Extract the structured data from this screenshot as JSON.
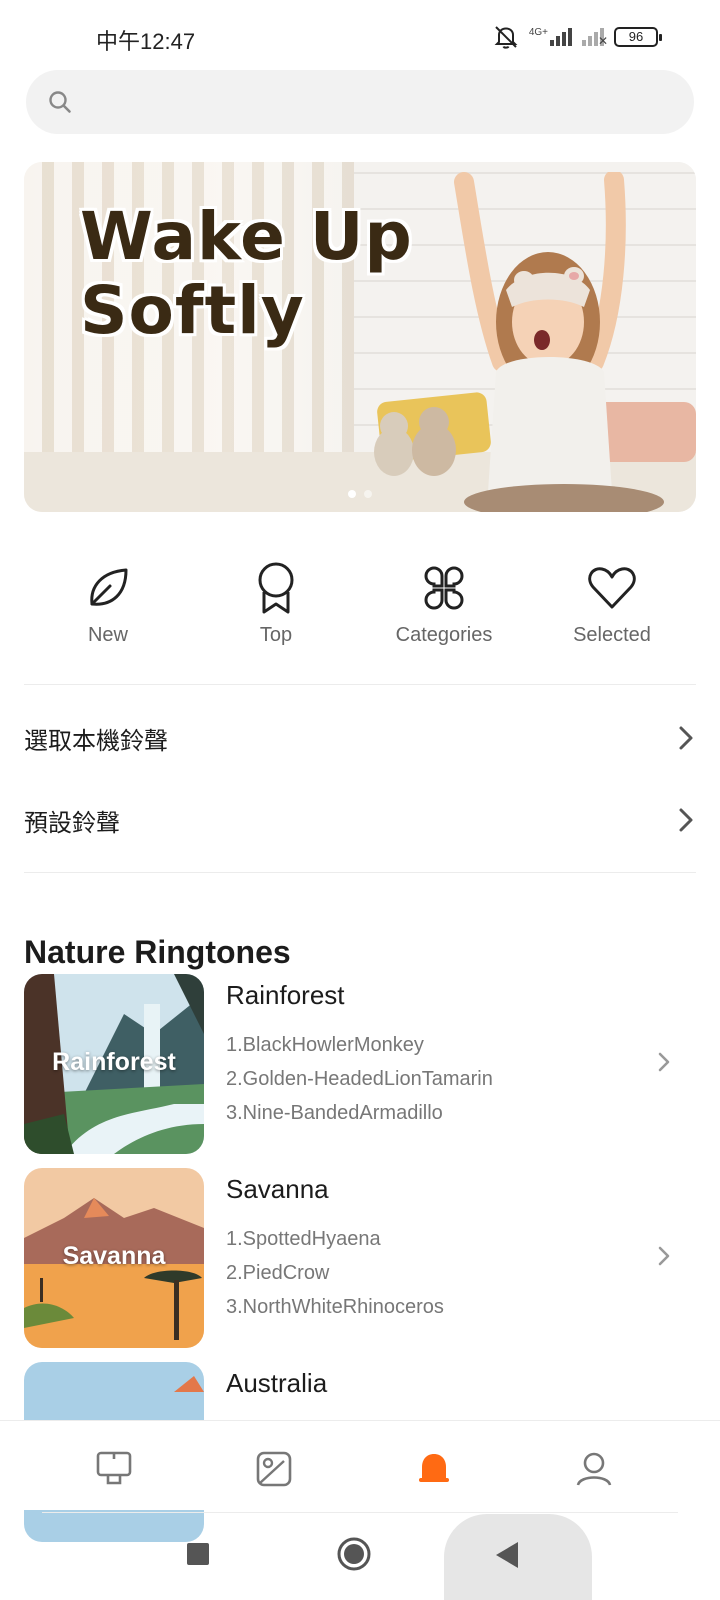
{
  "status_bar": {
    "time": "中午12:47",
    "network": "4G+",
    "battery": "96"
  },
  "search": {
    "placeholder": ""
  },
  "banner": {
    "title_line1": "Wake Up",
    "title_line2": "Softly",
    "page_count": 2,
    "active_page": 1
  },
  "quick_nav": [
    {
      "label": "New",
      "icon": "leaf-icon"
    },
    {
      "label": "Top",
      "icon": "ribbon-badge-icon"
    },
    {
      "label": "Categories",
      "icon": "clover-grid-icon"
    },
    {
      "label": "Selected",
      "icon": "heart-icon"
    }
  ],
  "menu": {
    "local_ringtone": "選取本機鈴聲",
    "default_ringtone": "預設鈴聲"
  },
  "section": {
    "title": "Nature Ringtones"
  },
  "cards": [
    {
      "title": "Rainforest",
      "thumb_label": "Rainforest",
      "items": [
        "1.BlackHowlerMonkey",
        "2.Golden-HeadedLionTamarin",
        "3.Nine-BandedArmadillo"
      ]
    },
    {
      "title": "Savanna",
      "thumb_label": "Savanna",
      "items": [
        "1.SpottedHyaena",
        "2.PiedCrow",
        "3.NorthWhiteRhinoceros"
      ]
    },
    {
      "title": "Australia",
      "thumb_label": "",
      "items": []
    }
  ],
  "bottom_nav": [
    {
      "icon": "display-stand-icon",
      "active": false
    },
    {
      "icon": "wallpaper-icon",
      "active": false
    },
    {
      "icon": "bell-icon",
      "active": true
    },
    {
      "icon": "profile-icon",
      "active": false
    }
  ],
  "colors": {
    "accent": "#ff6a13",
    "text_primary": "#1c1c1c",
    "text_secondary": "#777777",
    "search_bg": "#f2f2f2"
  }
}
